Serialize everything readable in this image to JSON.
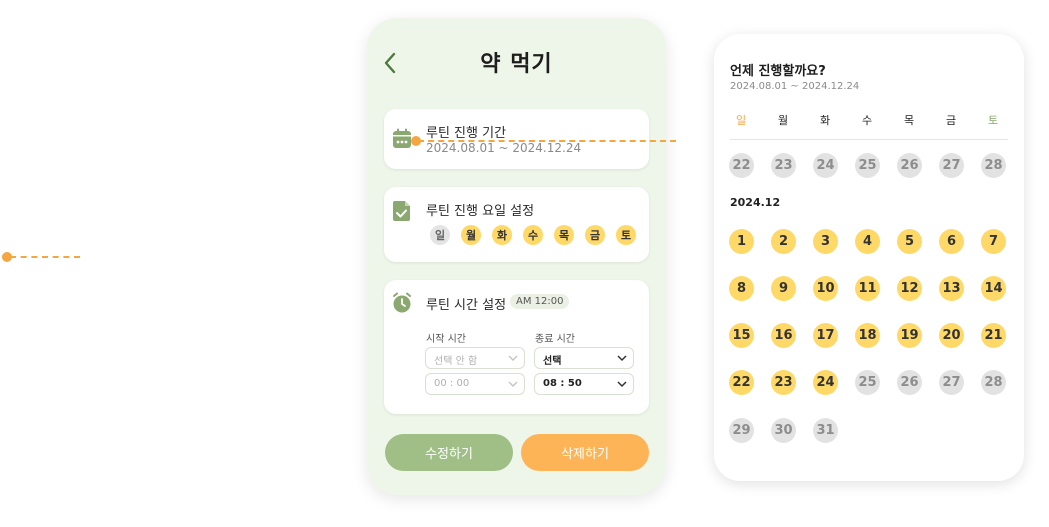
{
  "header": {
    "title": "약 먹기",
    "back_icon": "chevron-left-icon"
  },
  "period_card": {
    "icon": "calendar-icon",
    "label": "루틴 진행 기간",
    "value": "2024.08.01 ~ 2024.12.24"
  },
  "days_card": {
    "icon": "document-check-icon",
    "label": "루틴 진행 요일 설정",
    "days": [
      {
        "label": "일",
        "selected": false
      },
      {
        "label": "월",
        "selected": true
      },
      {
        "label": "화",
        "selected": true
      },
      {
        "label": "수",
        "selected": true
      },
      {
        "label": "목",
        "selected": true
      },
      {
        "label": "금",
        "selected": true
      },
      {
        "label": "토",
        "selected": true
      }
    ]
  },
  "time_card": {
    "icon": "alarm-clock-icon",
    "label": "루틴 시간 설정",
    "badge": "AM 12:00",
    "start_label": "시작 시간",
    "end_label": "종료 시간",
    "start_select": "선택 안 함",
    "start_time": "00 : 00",
    "end_select": "선택",
    "end_time": "08 : 50"
  },
  "actions": {
    "edit": "수정하기",
    "delete": "삭제하기"
  },
  "calendar": {
    "title": "언제 진행할까요?",
    "range": "2024.08.01 ~ 2024.12.24",
    "weekdays": [
      "일",
      "월",
      "화",
      "수",
      "목",
      "금",
      "토"
    ],
    "prev_week": [
      22,
      23,
      24,
      25,
      26,
      27,
      28
    ],
    "month_label": "2024.12",
    "december_days": 31,
    "routine_end_day": 24
  },
  "colors": {
    "accent_green": "#9fbf86",
    "accent_orange": "#fdb457",
    "highlight": "#ffd967",
    "background": "#eef6e9"
  }
}
